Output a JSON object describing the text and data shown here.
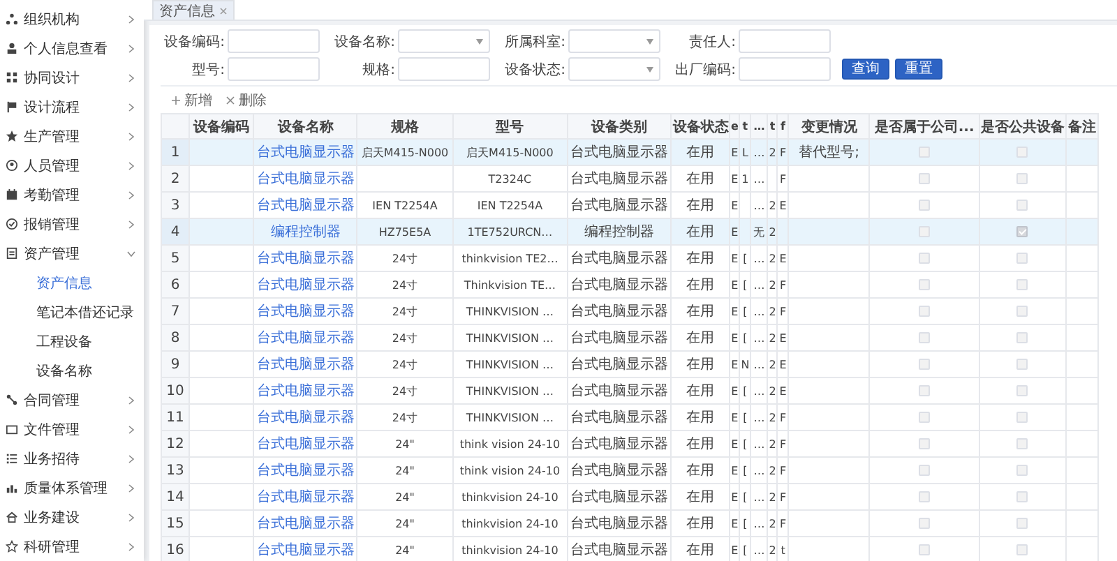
{
  "sidebar": {
    "items": [
      {
        "label": "组织机构",
        "expanded": false
      },
      {
        "label": "个人信息查看",
        "expanded": false
      },
      {
        "label": "协同设计",
        "expanded": false
      },
      {
        "label": "设计流程",
        "expanded": false
      },
      {
        "label": "生产管理",
        "expanded": false
      },
      {
        "label": "人员管理",
        "expanded": false
      },
      {
        "label": "考勤管理",
        "expanded": false
      },
      {
        "label": "报销管理",
        "expanded": false
      },
      {
        "label": "资产管理",
        "expanded": true,
        "children": [
          {
            "label": "资产信息",
            "selected": true
          },
          {
            "label": "笔记本借还记录",
            "selected": false
          },
          {
            "label": "工程设备",
            "selected": false
          },
          {
            "label": "设备名称",
            "selected": false
          }
        ]
      },
      {
        "label": "合同管理",
        "expanded": false
      },
      {
        "label": "文件管理",
        "expanded": false
      },
      {
        "label": "业务招待",
        "expanded": false
      },
      {
        "label": "质量体系管理",
        "expanded": false
      },
      {
        "label": "业务建设",
        "expanded": false
      },
      {
        "label": "科研管理",
        "expanded": false
      }
    ]
  },
  "tabs": [
    {
      "label": "资产信息",
      "selected": true
    }
  ],
  "filters": [
    {
      "label": "设备编码:",
      "kind": "input"
    },
    {
      "label": "设备名称:",
      "kind": "select"
    },
    {
      "label": "所属科室:",
      "kind": "select"
    },
    {
      "label": "责任人:",
      "kind": "input"
    },
    {
      "label": "型号:",
      "kind": "input"
    },
    {
      "label": "规格:",
      "kind": "input"
    },
    {
      "label": "设备状态:",
      "kind": "select"
    },
    {
      "label": "出厂编码:",
      "kind": "input"
    }
  ],
  "buttons": [
    "查询",
    "重置"
  ],
  "toolbar": [
    {
      "label": "新增",
      "kind": "add"
    },
    {
      "label": "删除",
      "kind": "delete"
    }
  ],
  "table": {
    "columns": [
      "设备编码",
      "设备名称",
      "规格",
      "型号",
      "设备类别",
      "设备状态",
      "e",
      "t",
      "…",
      "t",
      "f",
      "变更情况",
      "是否属于公司...",
      "是否公共设备",
      "备注"
    ],
    "rows": [
      {
        "selected": true,
        "no": "1",
        "name": "台式电脑显示器",
        "spec": "启天M415-N000",
        "model": "启天M415-N000",
        "category": "台式电脑显示器",
        "status": "在用",
        "c8": "E",
        "c9": "L",
        "c10": "…",
        "c11": "2",
        "c12": "F",
        "change": "替代型号;",
        "company": false,
        "public": false
      },
      {
        "selected": false,
        "no": "2",
        "name": "台式电脑显示器",
        "model": "T2324C",
        "category": "台式电脑显示器",
        "status": "在用",
        "c8": "E",
        "c9": "1",
        "c10": "…",
        "c12": "F",
        "company": false,
        "public": false
      },
      {
        "selected": false,
        "no": "3",
        "name": "台式电脑显示器",
        "spec": "IEN T2254A",
        "model": "IEN T2254A",
        "category": "台式电脑显示器",
        "status": "在用",
        "c8": "E",
        "c10": "…",
        "c11": "2",
        "c12": "E",
        "company": false,
        "public": false
      },
      {
        "selected": true,
        "no": "4",
        "name": "编程控制器",
        "spec": "HZ75E5A",
        "model": "1TE752URCN…",
        "category": "编程控制器",
        "status": "在用",
        "c8": "E",
        "c10": "无",
        "c11": "2",
        "company": false,
        "public": true
      },
      {
        "selected": false,
        "no": "5",
        "name": "台式电脑显示器",
        "spec": "24寸",
        "model": "thinkvision TE2…",
        "category": "台式电脑显示器",
        "status": "在用",
        "c8": "E",
        "c9": "[",
        "c10": "…",
        "c11": "2",
        "c12": "E",
        "company": false,
        "public": false
      },
      {
        "selected": false,
        "no": "6",
        "name": "台式电脑显示器",
        "spec": "24寸",
        "model": "Thinkvision TE…",
        "category": "台式电脑显示器",
        "status": "在用",
        "c8": "E",
        "c9": "[",
        "c10": "…",
        "c11": "2",
        "c12": "F",
        "company": false,
        "public": false
      },
      {
        "selected": false,
        "no": "7",
        "name": "台式电脑显示器",
        "spec": "24寸",
        "model": "THINKVISION …",
        "category": "台式电脑显示器",
        "status": "在用",
        "c8": "E",
        "c9": "[",
        "c10": "…",
        "c11": "2",
        "c12": "F",
        "company": false,
        "public": false
      },
      {
        "selected": false,
        "no": "8",
        "name": "台式电脑显示器",
        "spec": "24寸",
        "model": "THINKVISION …",
        "category": "台式电脑显示器",
        "status": "在用",
        "c8": "E",
        "c9": "[",
        "c10": "…",
        "c11": "2",
        "c12": "E",
        "company": false,
        "public": false
      },
      {
        "selected": false,
        "no": "9",
        "name": "台式电脑显示器",
        "spec": "24寸",
        "model": "THINKVISION …",
        "category": "台式电脑显示器",
        "status": "在用",
        "c8": "E",
        "c9": "N",
        "c10": "…",
        "c11": "2",
        "c12": "E",
        "company": false,
        "public": false
      },
      {
        "selected": false,
        "no": "10",
        "name": "台式电脑显示器",
        "spec": "24寸",
        "model": "THINKVISION …",
        "category": "台式电脑显示器",
        "status": "在用",
        "c8": "E",
        "c9": "[",
        "c10": "…",
        "c11": "2",
        "c12": "E",
        "company": false,
        "public": false
      },
      {
        "selected": false,
        "no": "11",
        "name": "台式电脑显示器",
        "spec": "24寸",
        "model": "THINKVISION …",
        "category": "台式电脑显示器",
        "status": "在用",
        "c8": "E",
        "c9": "[",
        "c10": "…",
        "c11": "2",
        "c12": "F",
        "company": false,
        "public": false
      },
      {
        "selected": false,
        "no": "12",
        "name": "台式电脑显示器",
        "spec": "24\"",
        "model": "think vision 24-10",
        "category": "台式电脑显示器",
        "status": "在用",
        "c8": "E",
        "c9": "[",
        "c10": "…",
        "c11": "2",
        "c12": "F",
        "company": false,
        "public": false
      },
      {
        "selected": false,
        "no": "13",
        "name": "台式电脑显示器",
        "spec": "24\"",
        "model": "think vision 24-10",
        "category": "台式电脑显示器",
        "status": "在用",
        "c8": "E",
        "c9": "[",
        "c10": "…",
        "c11": "2",
        "c12": "F",
        "company": false,
        "public": false
      },
      {
        "selected": false,
        "no": "14",
        "name": "台式电脑显示器",
        "spec": "24\"",
        "model": "thinkvision 24-10",
        "category": "台式电脑显示器",
        "status": "在用",
        "c8": "E",
        "c9": "[",
        "c10": "…",
        "c11": "2",
        "c12": "F",
        "company": false,
        "public": false
      },
      {
        "selected": false,
        "no": "15",
        "name": "台式电脑显示器",
        "spec": "24\"",
        "model": "thinkvision 24-10",
        "category": "台式电脑显示器",
        "status": "在用",
        "c8": "E",
        "c9": "[",
        "c10": "…",
        "c11": "2",
        "c12": "F",
        "company": false,
        "public": false
      },
      {
        "selected": false,
        "no": "16",
        "name": "台式电脑显示器",
        "spec": "24\"",
        "model": "thinkvision 24-10",
        "category": "台式电脑显示器",
        "status": "在用",
        "c8": "E",
        "c9": "[",
        "c10": "…",
        "c11": "2",
        "c12": "t",
        "company": false,
        "public": false
      }
    ]
  }
}
